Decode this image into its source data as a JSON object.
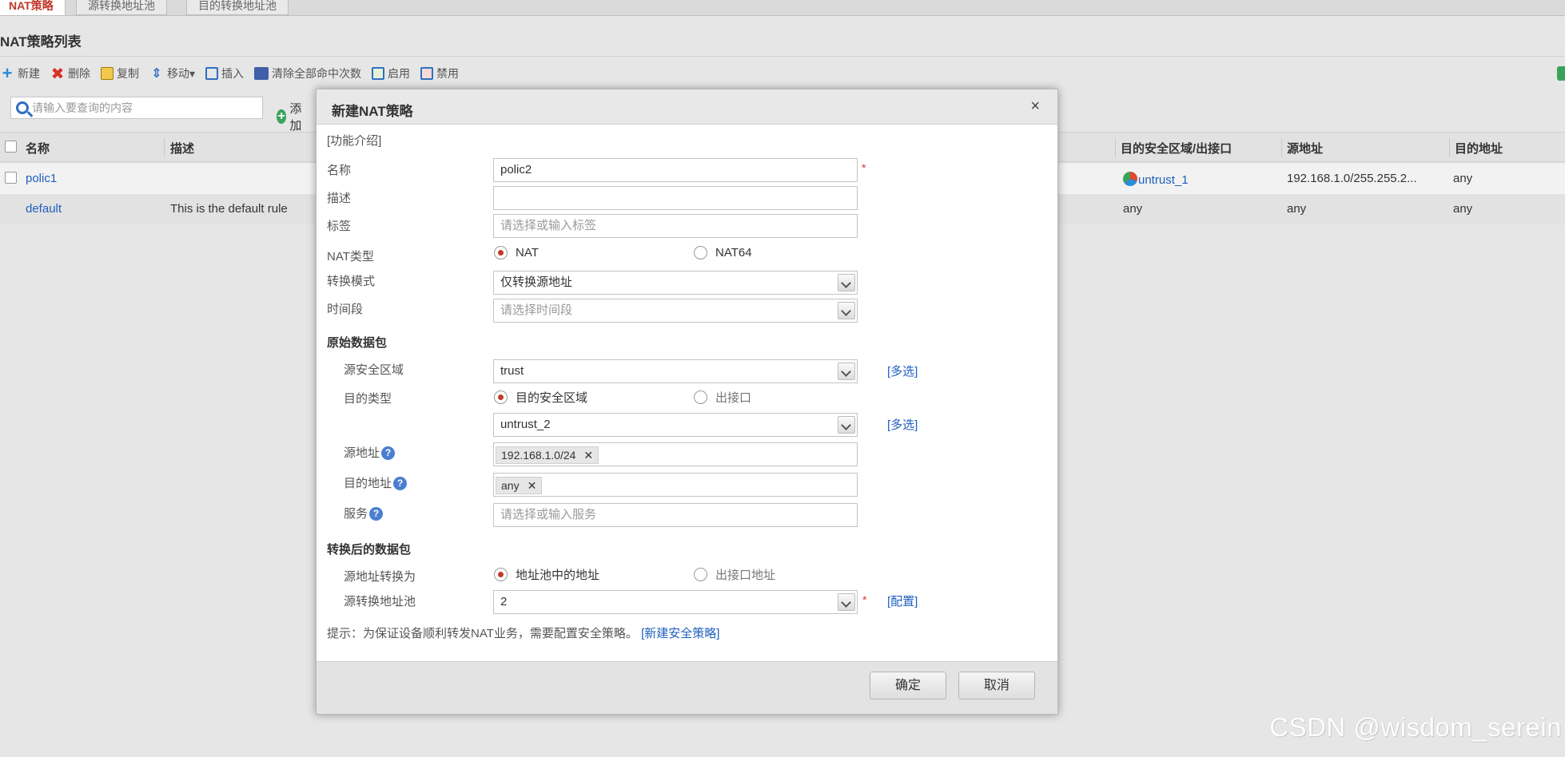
{
  "tabs": [
    "NAT策略",
    "源转换地址池",
    "目的转换地址池"
  ],
  "section_title": "NAT策略列表",
  "toolbar": {
    "new": "新建",
    "delete": "删除",
    "copy": "复制",
    "move": "移动▾",
    "insert": "插入",
    "clear_hits": "清除全部命中次数",
    "enable": "启用",
    "disable": "禁用"
  },
  "search": {
    "placeholder": "请输入要查询的内容",
    "add_condition": "添加"
  },
  "table": {
    "columns": {
      "name": "名称",
      "desc": "描述",
      "dst_zone": "目的安全区域/出接口",
      "src_addr": "源地址",
      "dst_addr": "目的地址"
    },
    "rows": [
      {
        "name": "polic1",
        "desc": "",
        "dst_zone": "untrust_1",
        "src_addr": "192.168.1.0/255.255.2...",
        "dst_addr": "any"
      },
      {
        "name": "default",
        "desc": "This is the default rule",
        "dst_zone": "any",
        "src_addr": "any",
        "dst_addr": "any"
      }
    ]
  },
  "modal": {
    "title": "新建NAT策略",
    "close": "×",
    "intro_link": "[功能介绍]",
    "fields": {
      "name_label": "名称",
      "name_value": "polic2",
      "desc_label": "描述",
      "desc_value": "",
      "tag_label": "标签",
      "tag_placeholder": "请选择或输入标签",
      "nat_type_label": "NAT类型",
      "nat_option": "NAT",
      "nat64_option": "NAT64",
      "mode_label": "转换模式",
      "mode_value": "仅转换源地址",
      "schedule_label": "时间段",
      "schedule_placeholder": "请选择时间段"
    },
    "original": {
      "header": "原始数据包",
      "src_zone_label": "源安全区域",
      "src_zone_value": "trust",
      "multi_select": "[多选]",
      "dst_type_label": "目的类型",
      "dst_type_zone": "目的安全区域",
      "dst_type_iface": "出接口",
      "dst_zone_value": "untrust_2",
      "src_addr_label": "源地址",
      "src_addr_tag": "192.168.1.0/24",
      "dst_addr_label": "目的地址",
      "dst_addr_tag": "any",
      "service_label": "服务",
      "service_placeholder": "请选择或输入服务"
    },
    "translated": {
      "header": "转换后的数据包",
      "src_translate_label": "源地址转换为",
      "opt_pool": "地址池中的地址",
      "opt_iface": "出接口地址",
      "pool_label": "源转换地址池",
      "pool_value": "2",
      "config_link": "[配置]"
    },
    "hint": "提示：为保证设备顺利转发NAT业务，需要配置安全策略。",
    "hint_link": "[新建安全策略]",
    "ok": "确定",
    "cancel": "取消"
  },
  "watermark": "CSDN @wisdom_serein"
}
